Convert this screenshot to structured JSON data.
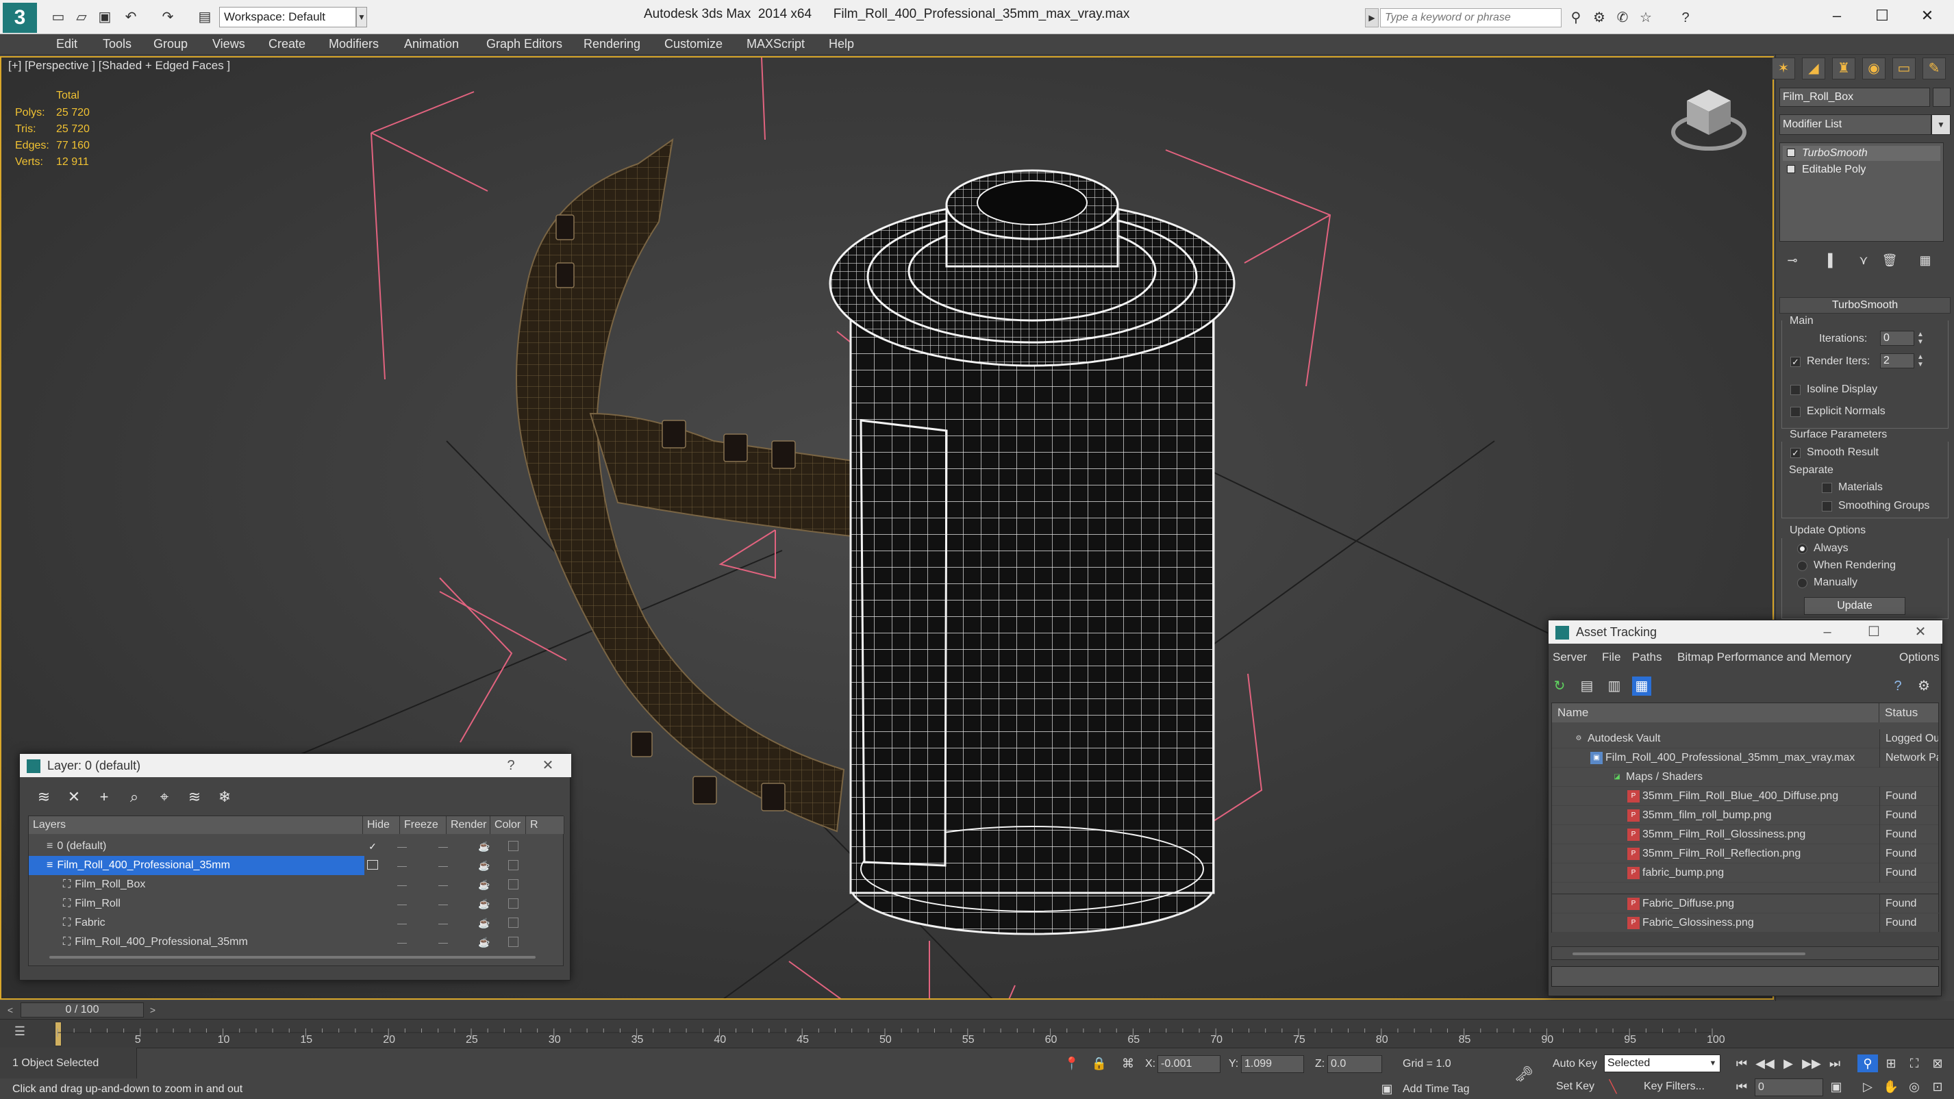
{
  "titlebar": {
    "workspace": "Workspace: Default",
    "app_title": "Autodesk 3ds Max  2014 x64",
    "file_name": "Film_Roll_400_Professional_35mm_max_vray.max",
    "search_placeholder": "Type a keyword or phrase"
  },
  "menu": [
    "Edit",
    "Tools",
    "Group",
    "Views",
    "Create",
    "Modifiers",
    "Animation",
    "Graph Editors",
    "Rendering",
    "Customize",
    "MAXScript",
    "Help"
  ],
  "viewport": {
    "label": "[+] [Perspective ] [Shaded + Edged Faces ]",
    "stats_header": "Total",
    "stats": [
      {
        "label": "Polys:",
        "value": "25 720"
      },
      {
        "label": "Tris:",
        "value": "25 720"
      },
      {
        "label": "Edges:",
        "value": "77 160"
      },
      {
        "label": "Verts:",
        "value": "12 911"
      }
    ]
  },
  "command_panel": {
    "object_name": "Film_Roll_Box",
    "modifier_list": "Modifier List",
    "stack": [
      "TurboSmooth",
      "Editable Poly"
    ],
    "rollout_title": "TurboSmooth",
    "main_label": "Main",
    "iterations_label": "Iterations:",
    "iterations_value": "0",
    "render_iters_label": "Render Iters:",
    "render_iters_value": "2",
    "isoline_label": "Isoline Display",
    "explicit_normals_label": "Explicit Normals",
    "surface_params_label": "Surface Parameters",
    "smooth_result_label": "Smooth Result",
    "separate_label": "Separate",
    "materials_label": "Materials",
    "smoothing_groups_label": "Smoothing Groups",
    "update_options_label": "Update Options",
    "always_label": "Always",
    "when_rendering_label": "When Rendering",
    "manually_label": "Manually",
    "update_button": "Update"
  },
  "layer_dialog": {
    "title": "Layer: 0 (default)",
    "help": "?",
    "columns": [
      "Layers",
      "Hide",
      "Freeze",
      "Render",
      "Color",
      "R"
    ],
    "rows": [
      {
        "name": "0 (default)",
        "color": "#7a2fd6"
      },
      {
        "name": "Film_Roll_400_Professional_35mm",
        "color": "#2c2c2c"
      },
      {
        "name": "Film_Roll_Box",
        "color": "#1a1a1a"
      },
      {
        "name": "Film_Roll",
        "color": "#1a1a1a"
      },
      {
        "name": "Fabric",
        "color": "#1a1a1a"
      },
      {
        "name": "Film_Roll_400_Professional_35mm",
        "color": "#1a1a1a"
      }
    ]
  },
  "asset_tracking": {
    "title": "Asset Tracking",
    "menus": [
      "Server",
      "File",
      "Paths",
      "Bitmap Performance and Memory",
      "Options"
    ],
    "columns": [
      "Name",
      "Status"
    ],
    "rows": [
      {
        "name": "Autodesk Vault",
        "status": "Logged Out"
      },
      {
        "name": "Film_Roll_400_Professional_35mm_max_vray.max",
        "status": "Network Path"
      },
      {
        "name": "Maps / Shaders",
        "status": ""
      },
      {
        "name": "35mm_Film_Roll_Blue_400_Diffuse.png",
        "status": "Found"
      },
      {
        "name": "35mm_film_roll_bump.png",
        "status": "Found"
      },
      {
        "name": "35mm_Film_Roll_Glossiness.png",
        "status": "Found"
      },
      {
        "name": "35mm_Film_Roll_Reflection.png",
        "status": "Found"
      },
      {
        "name": "fabric_bump.png",
        "status": "Found"
      },
      {
        "name": "Fabric_Diffuse.png",
        "status": "Found"
      },
      {
        "name": "Fabric_Glossiness.png",
        "status": "Found"
      }
    ]
  },
  "timeline": {
    "slider": "0 / 100",
    "ticks": [
      "5",
      "10",
      "15",
      "20",
      "25",
      "30",
      "35",
      "40",
      "45",
      "50",
      "55",
      "60",
      "65",
      "70",
      "75",
      "80",
      "85",
      "90",
      "95",
      "100"
    ]
  },
  "status": {
    "selection": "1 Object Selected",
    "prompt": "Click and drag up-and-down to zoom in and out",
    "x_label": "X:",
    "x_value": "-0.001",
    "y_label": "Y:",
    "y_value": "1.099",
    "z_label": "Z:",
    "z_value": "0.0",
    "grid": "Grid = 1.0",
    "add_time_tag": "Add Time Tag",
    "auto_key": "Auto Key",
    "set_key": "Set Key",
    "selected": "Selected",
    "key_filters": "Key Filters...",
    "frame": "0"
  }
}
